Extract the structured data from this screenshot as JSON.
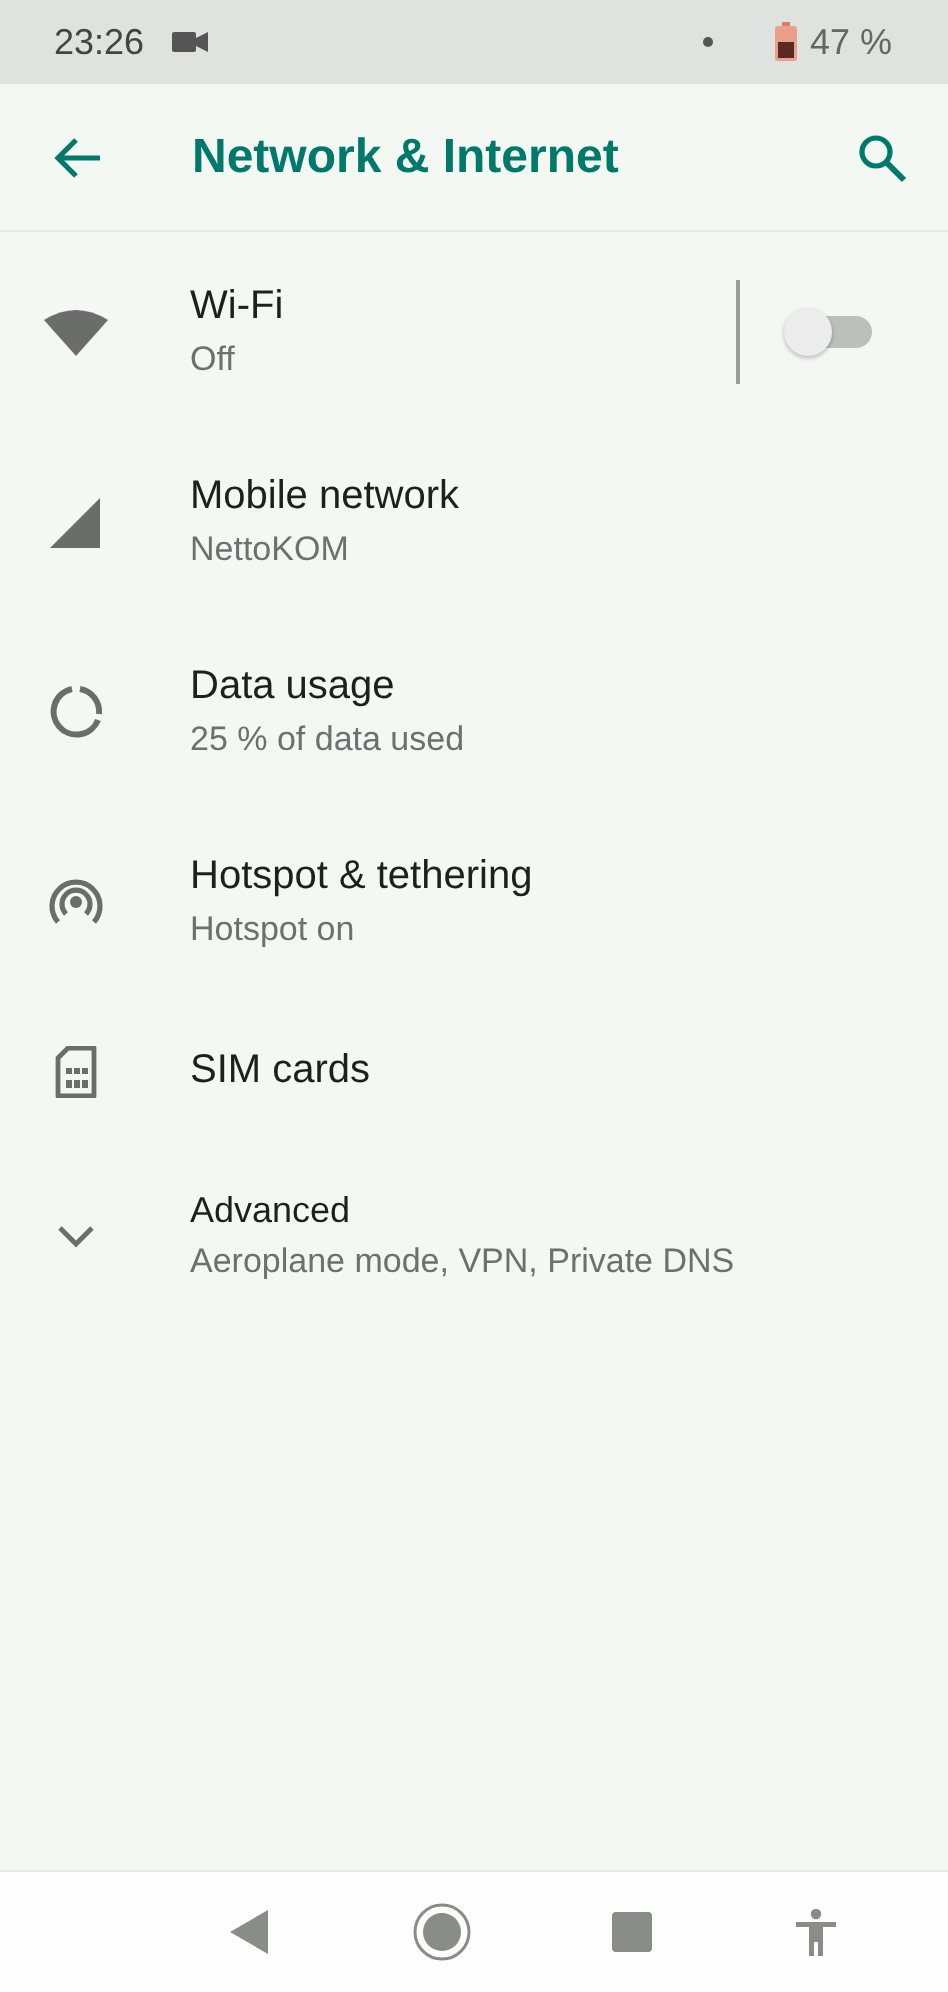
{
  "status_bar": {
    "time": "23:26",
    "battery": "47 %"
  },
  "app_bar": {
    "title": "Network & Internet"
  },
  "items": [
    {
      "kind": "wifi",
      "title": "Wi-Fi",
      "subtitle": "Off",
      "switch": {
        "on": false
      }
    },
    {
      "kind": "mobile",
      "title": "Mobile network",
      "subtitle": "NettoKOM"
    },
    {
      "kind": "data",
      "title": "Data usage",
      "subtitle": "25 % of data used"
    },
    {
      "kind": "hotspot",
      "title": "Hotspot & tethering",
      "subtitle": "Hotspot on"
    },
    {
      "kind": "sim",
      "title": "SIM cards"
    },
    {
      "kind": "advanced",
      "title": "Advanced",
      "subtitle": "Aeroplane mode, VPN, Private DNS"
    }
  ]
}
